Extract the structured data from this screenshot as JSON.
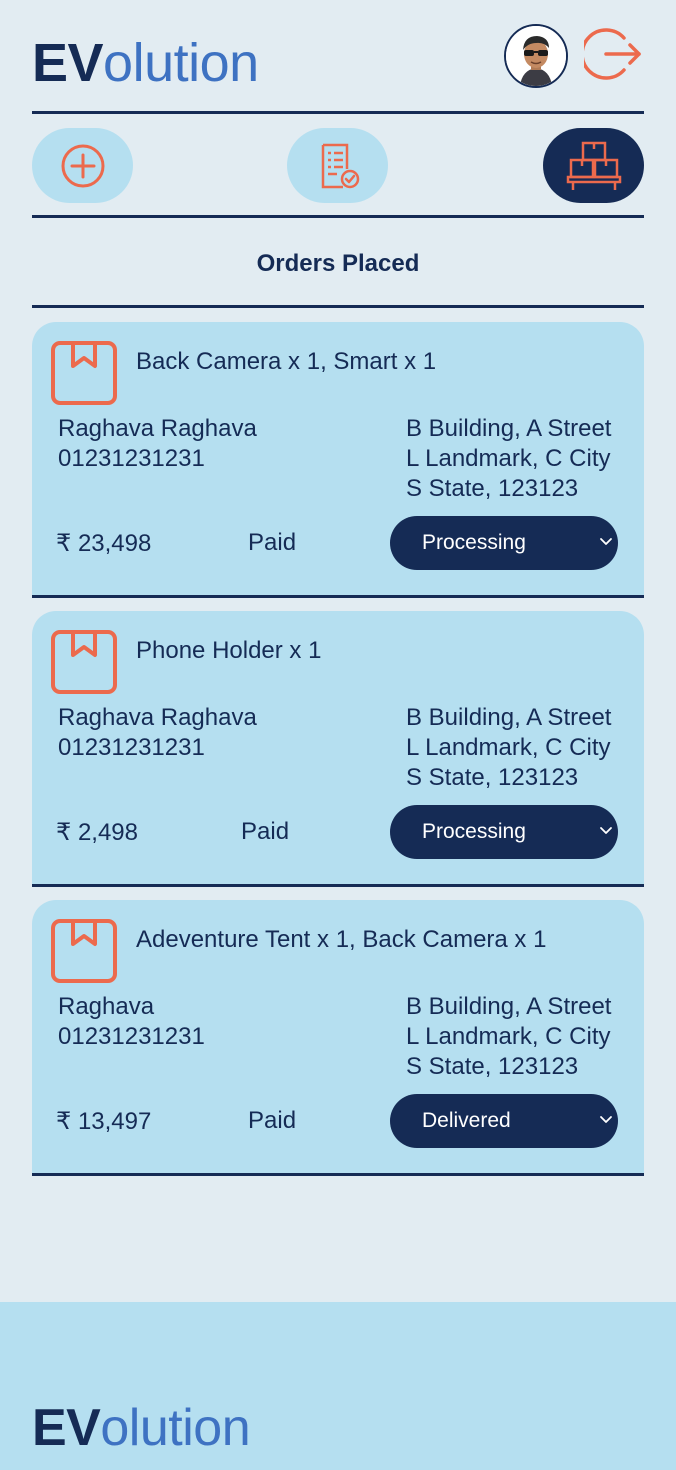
{
  "brand": {
    "logo_bold": "EV",
    "logo_rest": "olution"
  },
  "header": {
    "avatar_icon": "user-avatar",
    "logout_icon": "logout-icon"
  },
  "nav": [
    {
      "icon": "add-circle-icon",
      "active": false
    },
    {
      "icon": "order-list-icon",
      "active": false
    },
    {
      "icon": "boxes-icon",
      "active": true
    }
  ],
  "page": {
    "title": "Orders Placed"
  },
  "orders": [
    {
      "items": "Back Camera x 1, Smart x 1",
      "customer_name": "Raghava Raghava",
      "phone": "01231231231",
      "address_line1": "B Building, A Street",
      "address_line2": "L Landmark, C City",
      "address_line3": "S State, 123123",
      "price": "₹ 23,498",
      "payment": "Paid",
      "status": "Processing"
    },
    {
      "items": "Phone Holder x 1",
      "customer_name": "Raghava Raghava",
      "phone": "01231231231",
      "address_line1": "B Building, A Street",
      "address_line2": "L Landmark, C City",
      "address_line3": "S State, 123123",
      "price": "₹ 2,498",
      "payment": "Paid",
      "status": "Processing"
    },
    {
      "items": "Adeventure Tent x 1, Back Camera x 1",
      "customer_name": "Raghava",
      "phone": "01231231231",
      "address_line1": "B Building, A Street",
      "address_line2": "L Landmark, C City",
      "address_line3": "S State, 123123",
      "price": "₹ 13,497",
      "payment": "Paid",
      "status": "Delivered"
    }
  ],
  "footer": {
    "logo_bold": "EV",
    "logo_rest": "olution"
  },
  "colors": {
    "navy": "#152b55",
    "accent": "#ec6a4d",
    "card": "#b5dff0",
    "background": "#e2ecf2",
    "logo_blue": "#3e72c2"
  }
}
